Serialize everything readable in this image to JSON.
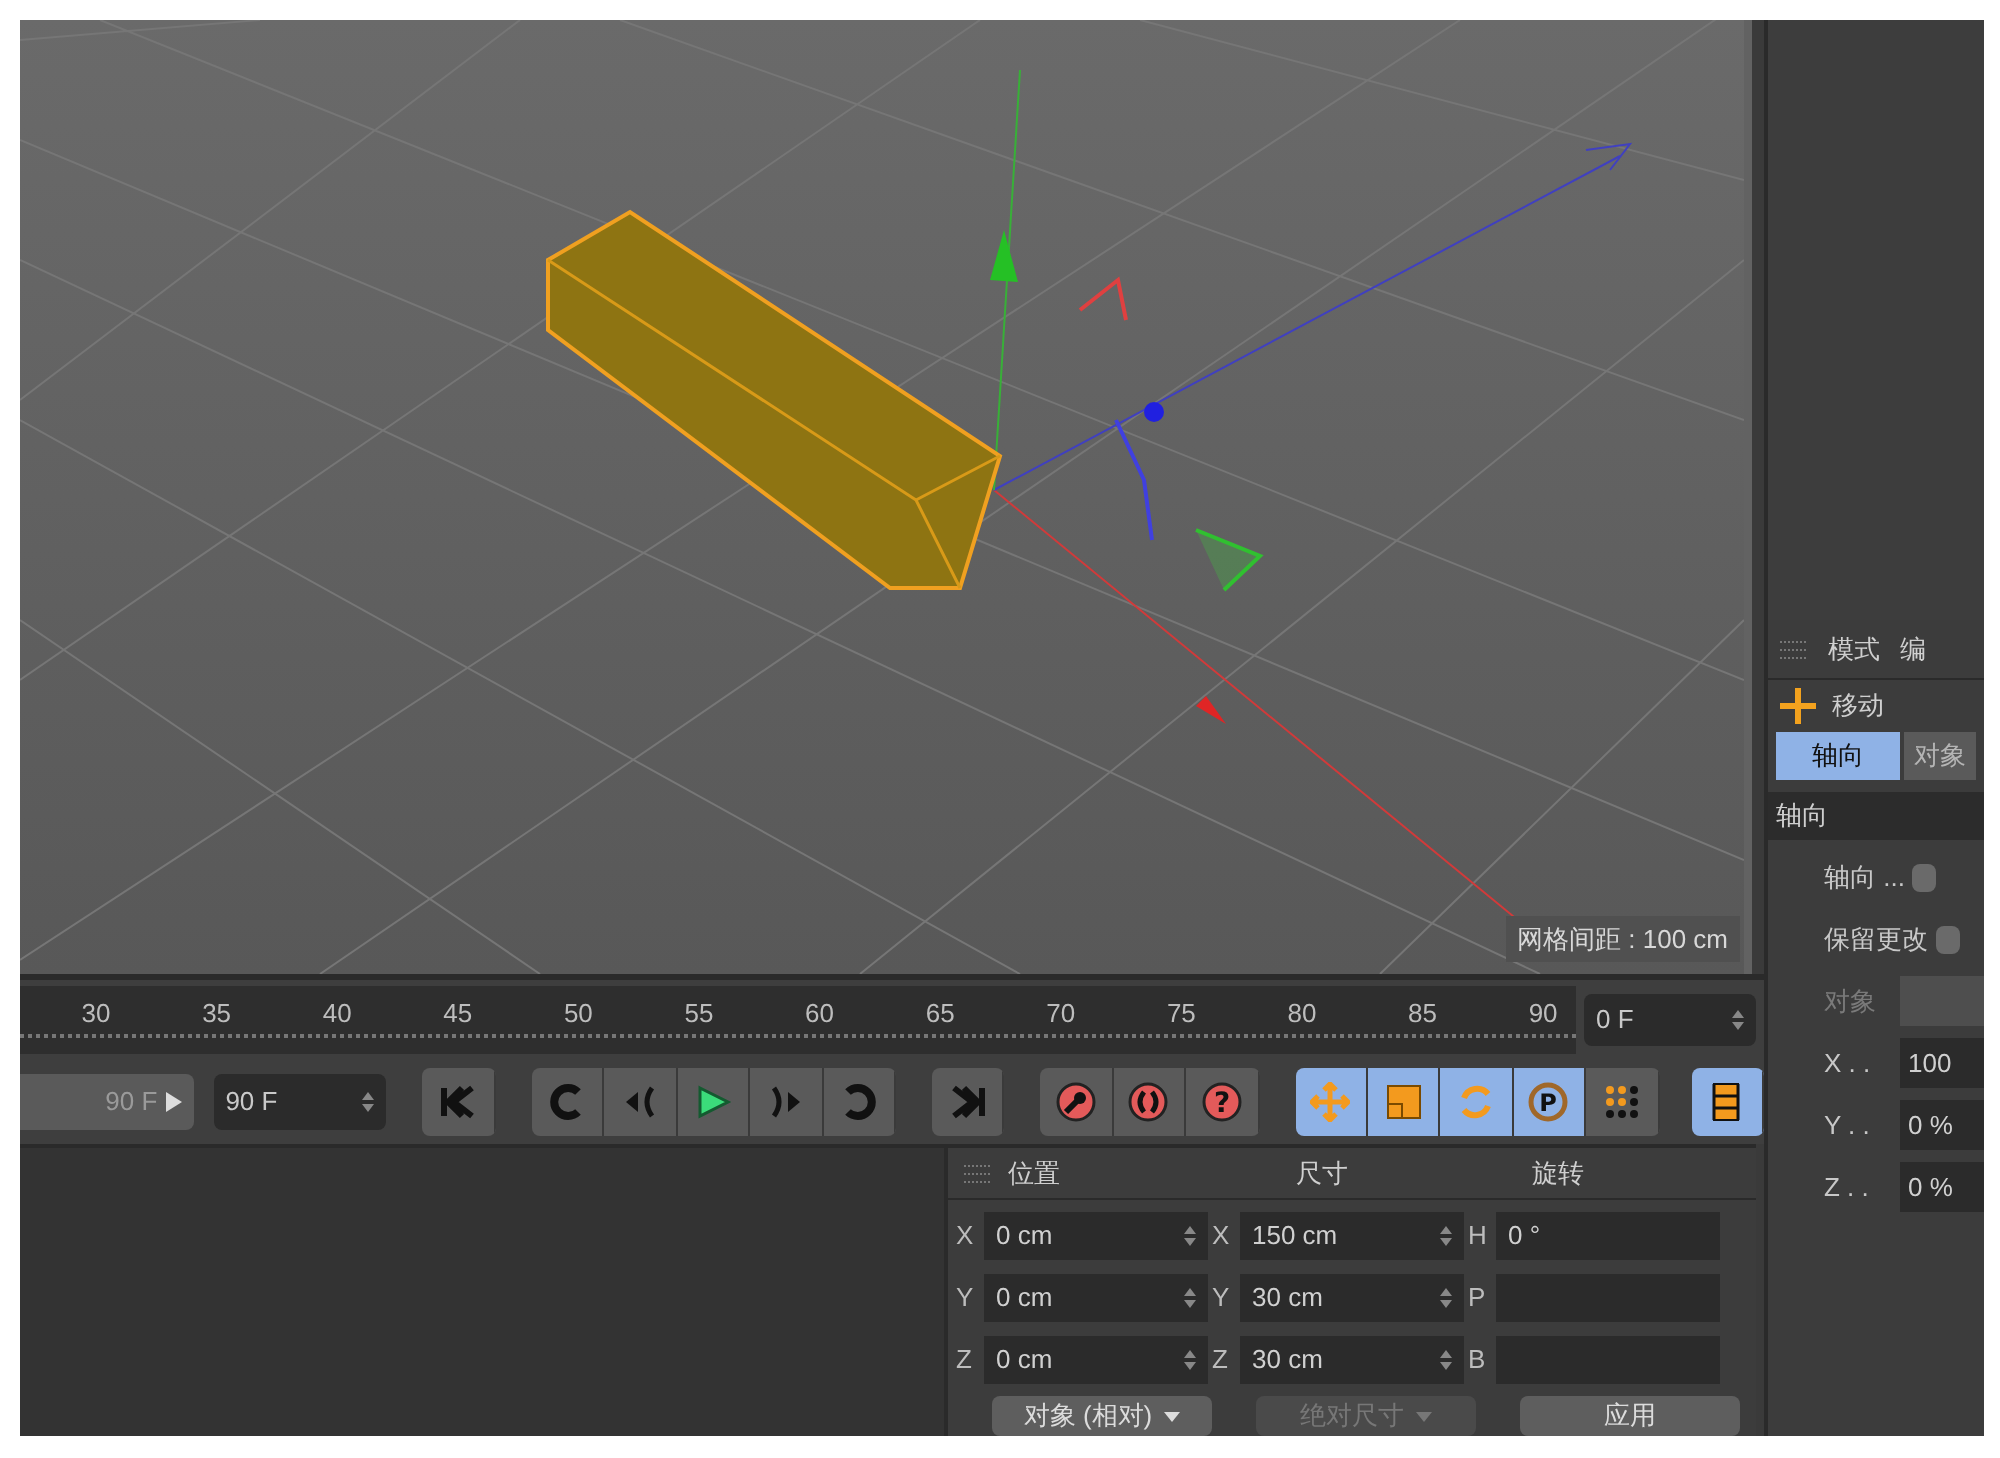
{
  "viewport": {
    "grid_label": "网格间距 : 100 cm"
  },
  "timeline": {
    "ticks": [
      "30",
      "35",
      "40",
      "45",
      "50",
      "55",
      "60",
      "65",
      "70",
      "75",
      "80",
      "85",
      "90"
    ],
    "current_frame": "0 F"
  },
  "transport": {
    "preview_field": "90 F",
    "end_field": "90 F",
    "groups": [
      [
        {
          "kind": "go-start"
        }
      ],
      [
        {
          "kind": "loop-back"
        },
        {
          "kind": "prev-key"
        },
        {
          "kind": "play"
        },
        {
          "kind": "next-key"
        },
        {
          "kind": "loop-forward"
        }
      ],
      [
        {
          "kind": "go-end"
        }
      ],
      [
        {
          "kind": "record"
        },
        {
          "kind": "autokey"
        },
        {
          "kind": "keyframe-select",
          "glyph": "?"
        }
      ],
      [
        {
          "kind": "move",
          "selected": true
        },
        {
          "kind": "scale",
          "selected": true
        },
        {
          "kind": "rotate",
          "selected": true
        },
        {
          "kind": "param",
          "glyph": "P",
          "selected": true
        },
        {
          "kind": "dots",
          "selected": false
        }
      ],
      [
        {
          "kind": "film",
          "selected": true
        }
      ]
    ]
  },
  "coordinates": {
    "headers": [
      "位置",
      "尺寸",
      "旋转"
    ],
    "columns": [
      [
        {
          "axis": "X",
          "value": "0 cm"
        },
        {
          "axis": "Y",
          "value": "0 cm"
        },
        {
          "axis": "Z",
          "value": "0 cm"
        }
      ],
      [
        {
          "axis": "X",
          "value": "150 cm"
        },
        {
          "axis": "Y",
          "value": "30 cm"
        },
        {
          "axis": "Z",
          "value": "30 cm"
        }
      ],
      [
        {
          "axis": "H",
          "value": "0 °"
        },
        {
          "axis": "P"
        },
        {
          "axis": "B"
        }
      ]
    ],
    "buttons": [
      {
        "label": "对象 (相对)",
        "kind": "dropdown",
        "disabled": false
      },
      {
        "label": "绝对尺寸",
        "kind": "dropdown",
        "disabled": true
      },
      {
        "label": "应用",
        "kind": "button",
        "disabled": false
      }
    ]
  },
  "attributes": {
    "menu": [
      "模式",
      "编"
    ],
    "tool": "移动",
    "tabs": [
      {
        "label": "轴向",
        "selected": true
      },
      {
        "label": "对象",
        "selected": false
      }
    ],
    "section": "轴向",
    "rows": [
      {
        "kind": "checkbox",
        "label": "轴向 ...",
        "checked": false,
        "disabled": false
      },
      {
        "kind": "checkbox",
        "label": "保留更改",
        "checked": false,
        "disabled": false
      },
      {
        "kind": "field",
        "label": "对象",
        "disabled": true
      },
      {
        "kind": "field",
        "label": "X . .",
        "value": "100",
        "disabled": false
      },
      {
        "kind": "field",
        "label": "Y . .",
        "value": "0 %",
        "disabled": false
      },
      {
        "kind": "field",
        "label": "Z . .",
        "value": "0 %",
        "disabled": false
      }
    ]
  }
}
